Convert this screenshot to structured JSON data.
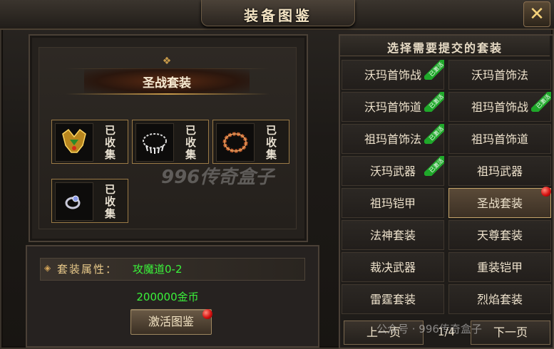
{
  "window": {
    "title": "装备图鉴",
    "close_label": "✕"
  },
  "left": {
    "set_name": "圣战套装",
    "items": [
      {
        "status": "已收集",
        "icon": "helmet-icon"
      },
      {
        "status": "已收集",
        "icon": "necklace-icon"
      },
      {
        "status": "已收集",
        "icon": "bracelet-icon"
      },
      {
        "status": "已收集",
        "icon": "ring-icon"
      }
    ],
    "attr_label": "套装属性：",
    "attr_value": "攻魔道0-2",
    "cost": "200000金币",
    "activate_label": "激活图鉴"
  },
  "right": {
    "header": "选择需要提交的套装",
    "sets": [
      {
        "label": "沃玛首饰战",
        "badge": "已激活"
      },
      {
        "label": "沃玛首饰法",
        "badge": ""
      },
      {
        "label": "沃玛首饰道",
        "badge": "已激活"
      },
      {
        "label": "祖玛首饰战",
        "badge": "已激活"
      },
      {
        "label": "祖玛首饰法",
        "badge": "已激活"
      },
      {
        "label": "祖玛首饰道",
        "badge": ""
      },
      {
        "label": "沃玛武器",
        "badge": "已激活"
      },
      {
        "label": "祖玛武器",
        "badge": ""
      },
      {
        "label": "祖玛铠甲",
        "badge": ""
      },
      {
        "label": "圣战套装",
        "badge": ""
      },
      {
        "label": "法神套装",
        "badge": ""
      },
      {
        "label": "天尊套装",
        "badge": ""
      },
      {
        "label": "裁决武器",
        "badge": ""
      },
      {
        "label": "重装铠甲",
        "badge": ""
      },
      {
        "label": "雷霆套装",
        "badge": ""
      },
      {
        "label": "烈焰套装",
        "badge": ""
      }
    ],
    "prev_label": "上一页",
    "next_label": "下一页",
    "page": "1/4"
  },
  "watermarks": {
    "center": "996传奇盒子",
    "footer": "公众号 · 996传奇盒子"
  },
  "colors": {
    "green_text": "#3af23a",
    "gold_text": "#e8c98a",
    "badge_green": "#1fa82a",
    "notify_red": "#d41010"
  }
}
